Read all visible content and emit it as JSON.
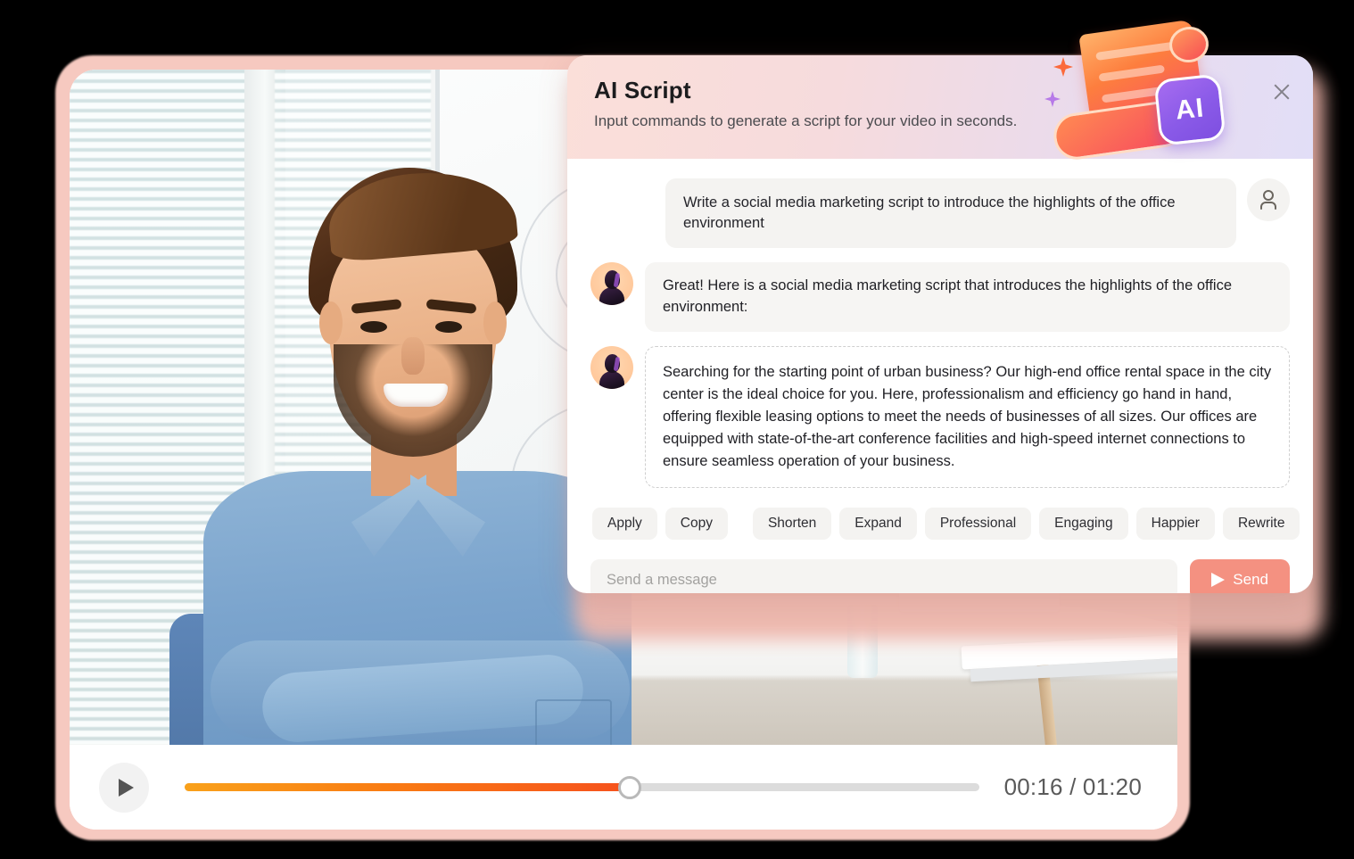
{
  "video": {
    "alt_description": "Smiling man in a blue shirt with arms crossed, standing in a bright office with a whiteboard and window blinds",
    "controls": {
      "play_icon": "play-icon",
      "current_time": "00:16",
      "total_time": "01:20",
      "time_display": "00:16 / 01:20",
      "progress_percent": 56
    }
  },
  "panel": {
    "title": "AI Script",
    "subtitle": "Input commands to generate a script for your video in seconds.",
    "close_icon": "close-icon",
    "badge": {
      "chip_label": "AI",
      "icon": "ai-scroll-badge-icon",
      "sparkle_orange": "sparkle-icon",
      "sparkle_purple": "sparkle-icon"
    },
    "colors": {
      "header_start": "#fbdfd9",
      "header_end": "#e2def7",
      "send_button": "#f49181",
      "accent_purple": "#8a5ae8",
      "progress_start": "#f9a11b",
      "progress_end": "#f6511d"
    },
    "conversation": {
      "user_prompt": "Write a social media marketing script to introduce the highlights of the office environment",
      "user_icon": "user-icon",
      "assistant_intro": "Great! Here is a social media marketing script that introduces the highlights of the office environment:",
      "assistant_script": "Searching for the starting point of urban business? Our high-end office rental space in the city center is the ideal choice for you. Here, professionalism and efficiency go hand in hand, offering flexible leasing options to meet the needs of businesses of all sizes. Our offices are equipped with state-of-the-art conference facilities and high-speed internet connections to ensure seamless operation of your business.",
      "assistant_avatar": "assistant-avatar-icon"
    },
    "actions": {
      "apply": "Apply",
      "copy": "Copy",
      "shorten": "Shorten",
      "expand": "Expand",
      "professional": "Professional",
      "engaging": "Engaging",
      "happier": "Happier",
      "rewrite": "Rewrite"
    },
    "composer": {
      "placeholder": "Send a message",
      "value": "",
      "send_label": "Send",
      "send_icon": "paper-plane-icon"
    }
  }
}
